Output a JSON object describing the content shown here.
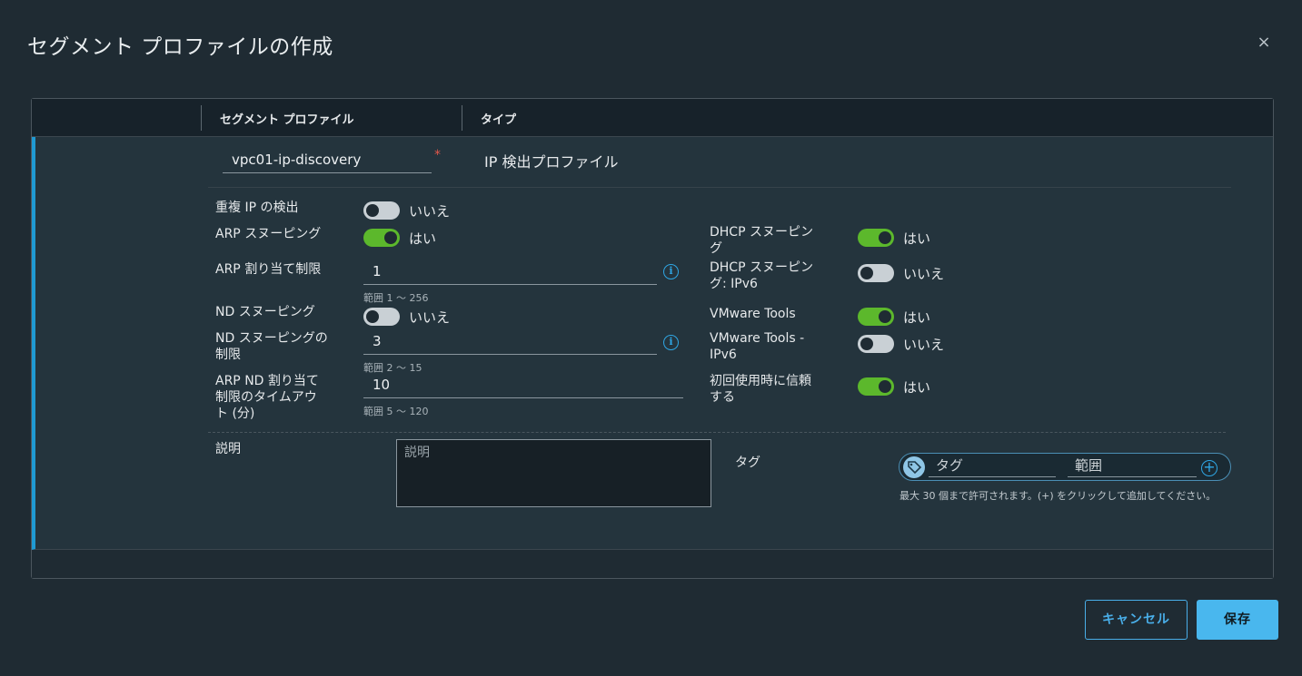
{
  "dialog": {
    "title": "セグメント プロファイルの作成",
    "close_icon": "close-icon"
  },
  "table": {
    "col_profile": "セグメント プロファイル",
    "col_type": "タイプ",
    "name_value": "vpc01-ip-discovery",
    "required_mark": "*",
    "type_value": "IP 検出プロファイル"
  },
  "left": {
    "dup_ip": {
      "label": "重複 IP の検出",
      "state": "いいえ",
      "on": false
    },
    "arp_snooping": {
      "label": "ARP スヌーピング",
      "state": "はい",
      "on": true
    },
    "arp_limit": {
      "label": "ARP 割り当て制限",
      "value": "1",
      "hint": "範囲 1 〜 256"
    },
    "nd_snooping": {
      "label": "ND スヌーピング",
      "state": "いいえ",
      "on": false
    },
    "nd_limit": {
      "label_line1": "ND スヌーピングの",
      "label_line2": "制限",
      "value": "3",
      "hint": "範囲 2 〜 15"
    },
    "arp_nd_timeout": {
      "label_line1": "ARP ND 割り当て",
      "label_line2": "制限のタイムアウ",
      "label_line3": "ト (分)",
      "value": "10",
      "hint": "範囲 5 〜 120"
    }
  },
  "right": {
    "dhcp_snooping": {
      "label_line1": "DHCP スヌーピン",
      "label_line2": "グ",
      "state": "はい",
      "on": true
    },
    "dhcp_snooping_v6": {
      "label_line1": "DHCP スヌーピン",
      "label_line2": "グ: IPv6",
      "state": "いいえ",
      "on": false
    },
    "vmware_tools": {
      "label": "VMware Tools",
      "state": "はい",
      "on": true
    },
    "vmware_tools_v6": {
      "label_line1": "VMware Tools -",
      "label_line2": "IPv6",
      "state": "いいえ",
      "on": false
    },
    "trust_first_use": {
      "label_line1": "初回使用時に信頼",
      "label_line2": "する",
      "state": "はい",
      "on": true
    }
  },
  "description": {
    "label": "説明",
    "placeholder": "説明"
  },
  "tags": {
    "label": "タグ",
    "tag_placeholder": "タグ",
    "scope_placeholder": "範囲",
    "help": "最大 30 個まで許可されます。(+) をクリックして追加してください。"
  },
  "footer": {
    "cancel_label": "キャンセル",
    "save_label": "保存"
  },
  "info_glyph": "i",
  "plus_glyph": "+",
  "close_glyph": "×",
  "colors": {
    "toggle_on": "#5cb82c",
    "accent": "#49b7ee",
    "row_marker": "#1f9ad3"
  }
}
